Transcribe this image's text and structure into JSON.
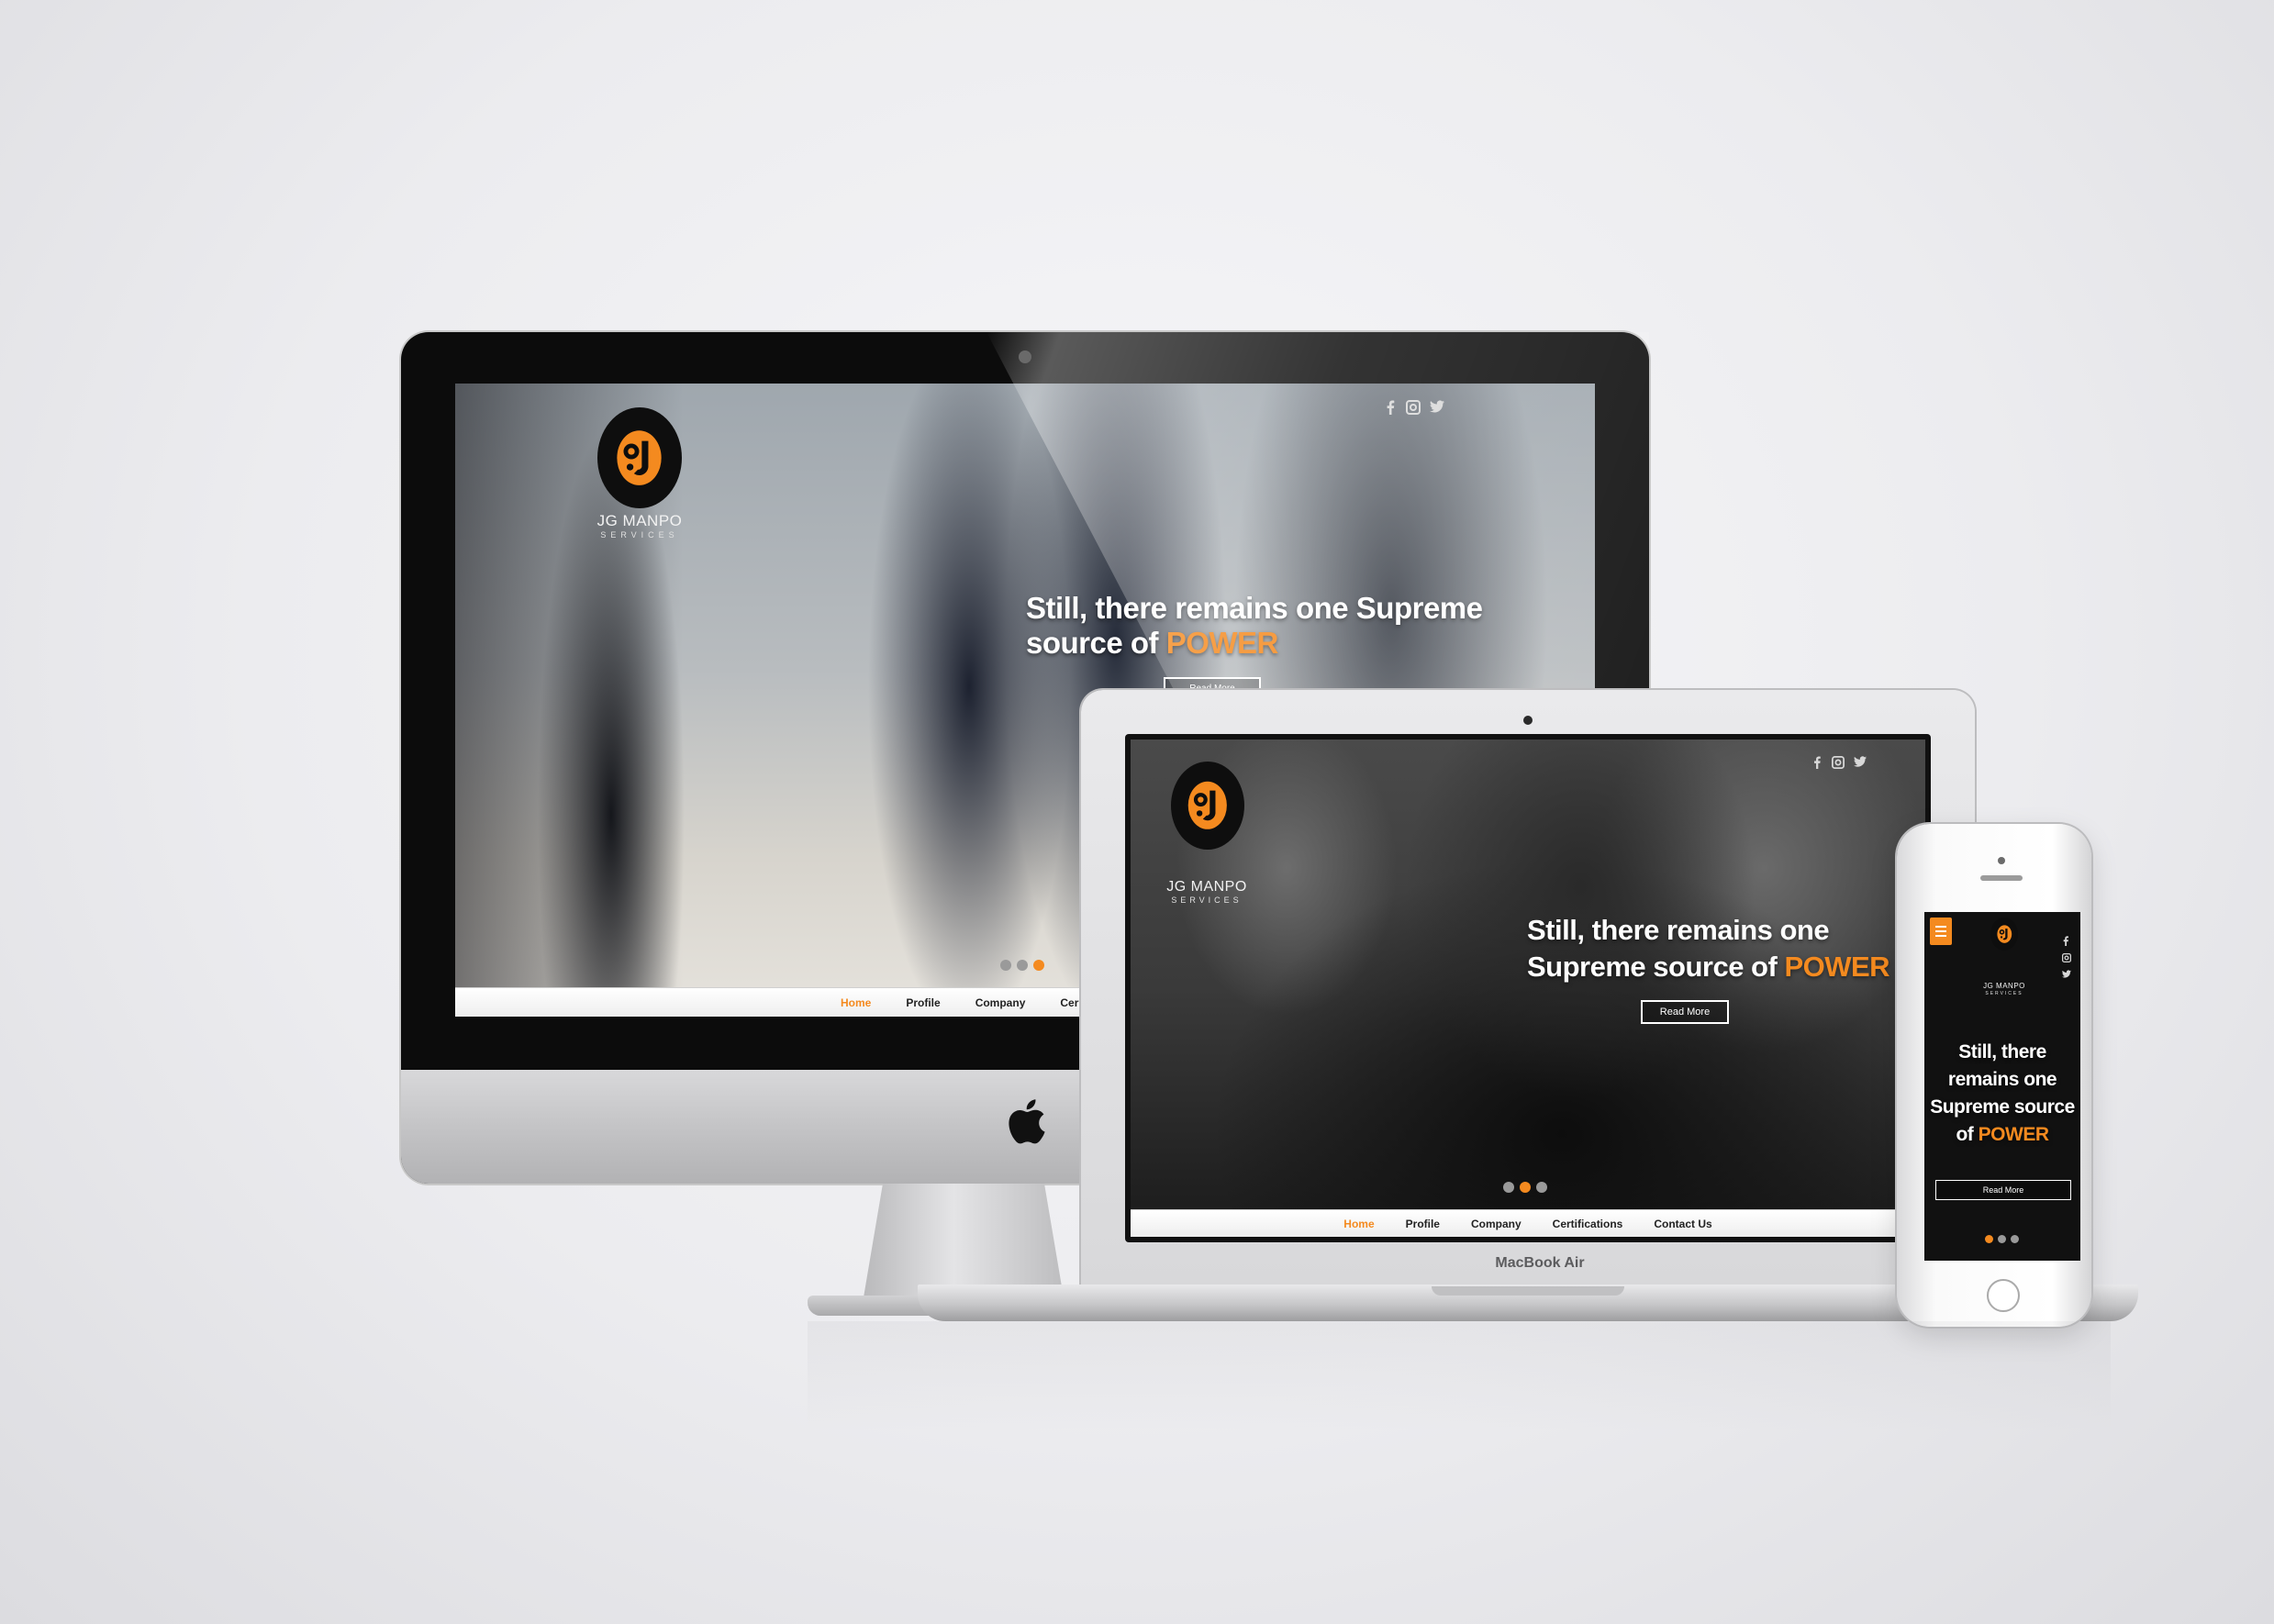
{
  "brand": {
    "name": "JG MANPO",
    "tagline": "SERVICES",
    "monogram": "gj",
    "accent_color": "#f48a1f"
  },
  "hero": {
    "headline_prefix": "Still, there remains one Supreme source of",
    "headline_line1": "Still, there remains one Supreme",
    "headline_line2_prefix": "source of",
    "mb_line1": "Still, there remains one",
    "mb_line2_prefix": "Supreme source of",
    "phone_line1": "Still, there",
    "phone_line2": "remains one",
    "phone_line3": "Supreme source",
    "phone_line4_prefix": "of",
    "highlight": "POWER",
    "cta": "Read More"
  },
  "nav": {
    "items": [
      "Home",
      "Profile",
      "Company",
      "Certifications",
      "Contact Us"
    ],
    "imac_visible": [
      "Home",
      "Profile",
      "Company",
      "Cer"
    ],
    "active": "Home"
  },
  "social": {
    "icons": [
      "facebook-icon",
      "instagram-icon",
      "twitter-icon"
    ]
  },
  "slider": {
    "imac_dots": 3,
    "imac_active": 3,
    "mb_dots": 3,
    "mb_active": 2,
    "phone_dots": 3,
    "phone_active": 1
  },
  "devices": {
    "laptop_label": "MacBook Air"
  }
}
